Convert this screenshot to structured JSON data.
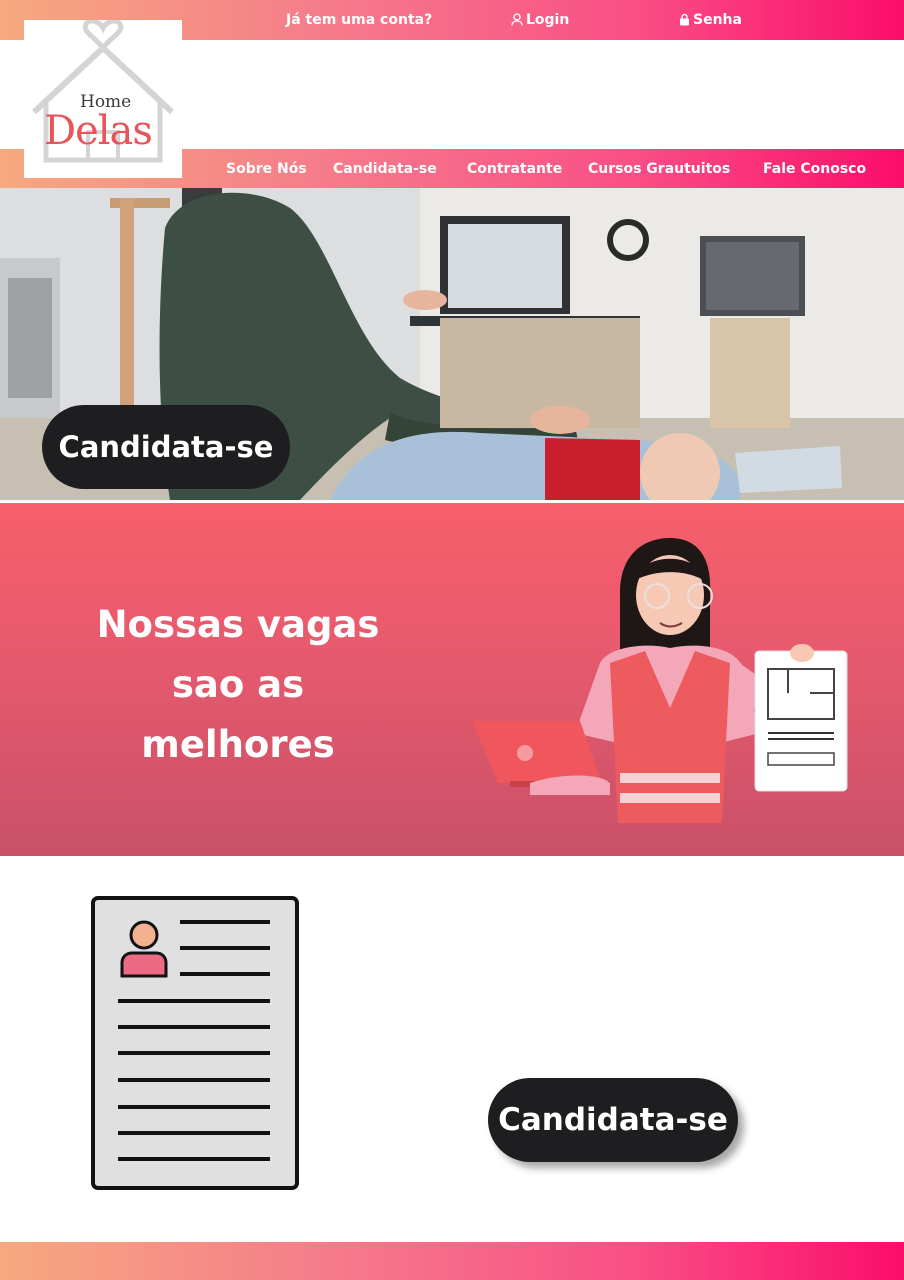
{
  "topbar": {
    "account_prompt": "Já tem uma conta?",
    "login_label": "Login",
    "password_label": "Senha"
  },
  "logo": {
    "home": "Home",
    "delas": "Delas"
  },
  "nav": {
    "items": [
      "Sobre Nós",
      "Candidata-se",
      "Contratante",
      "Cursos Grautuitos",
      "Fale Conosco"
    ]
  },
  "hero": {
    "cta_label": "Candidata-se"
  },
  "band": {
    "headline": "Nossas vagas sao as melhores"
  },
  "bottom": {
    "cta_label": "Candidata-se"
  },
  "icons": {
    "login": "user-icon",
    "password": "lock-icon",
    "resume": "resume-document-icon"
  },
  "colors": {
    "gradient_start": "#f6a97f",
    "gradient_end": "#fb0d6a",
    "band": "#e85a6d",
    "button": "#1e1e20",
    "brand_red": "#e9535a"
  }
}
